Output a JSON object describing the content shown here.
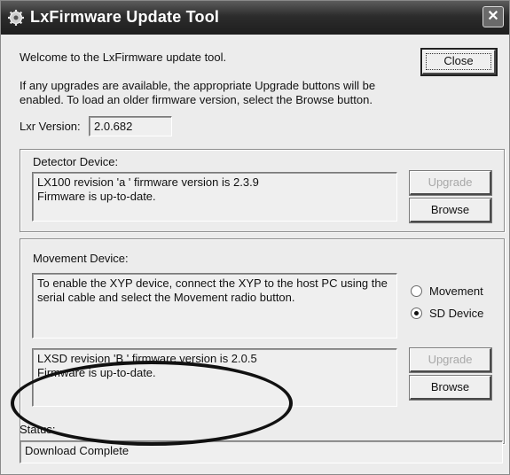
{
  "window": {
    "title": "LxFirmware Update Tool",
    "icon": "gear-icon",
    "close_icon": "close-icon"
  },
  "intro": {
    "welcome": "Welcome to the LxFirmware update tool.",
    "instructions": "If any upgrades are available, the appropriate Upgrade buttons will be\nenabled.  To load an older firmware version, select the Browse button."
  },
  "close_button": {
    "label": "Close"
  },
  "lxr": {
    "label": "Lxr Version:",
    "value": "2.0.682"
  },
  "detector": {
    "group_label": "Detector Device:",
    "info": "LX100 revision 'a ' firmware version is 2.3.9\nFirmware is up-to-date.",
    "upgrade_label": "Upgrade",
    "browse_label": "Browse"
  },
  "movement": {
    "group_label": "Movement Device:",
    "instructions": "To enable the XYP device, connect the XYP to the host PC using the\nserial cable and select the Movement radio button.",
    "radio_movement": "Movement",
    "radio_sd": "SD Device",
    "selected": "SD Device",
    "info": "LXSD revision 'B   ' firmware version is 2.0.5\nFirmware is up-to-date.",
    "upgrade_label": "Upgrade",
    "browse_label": "Browse"
  },
  "status": {
    "label": "Status:",
    "value": "Download Complete"
  }
}
